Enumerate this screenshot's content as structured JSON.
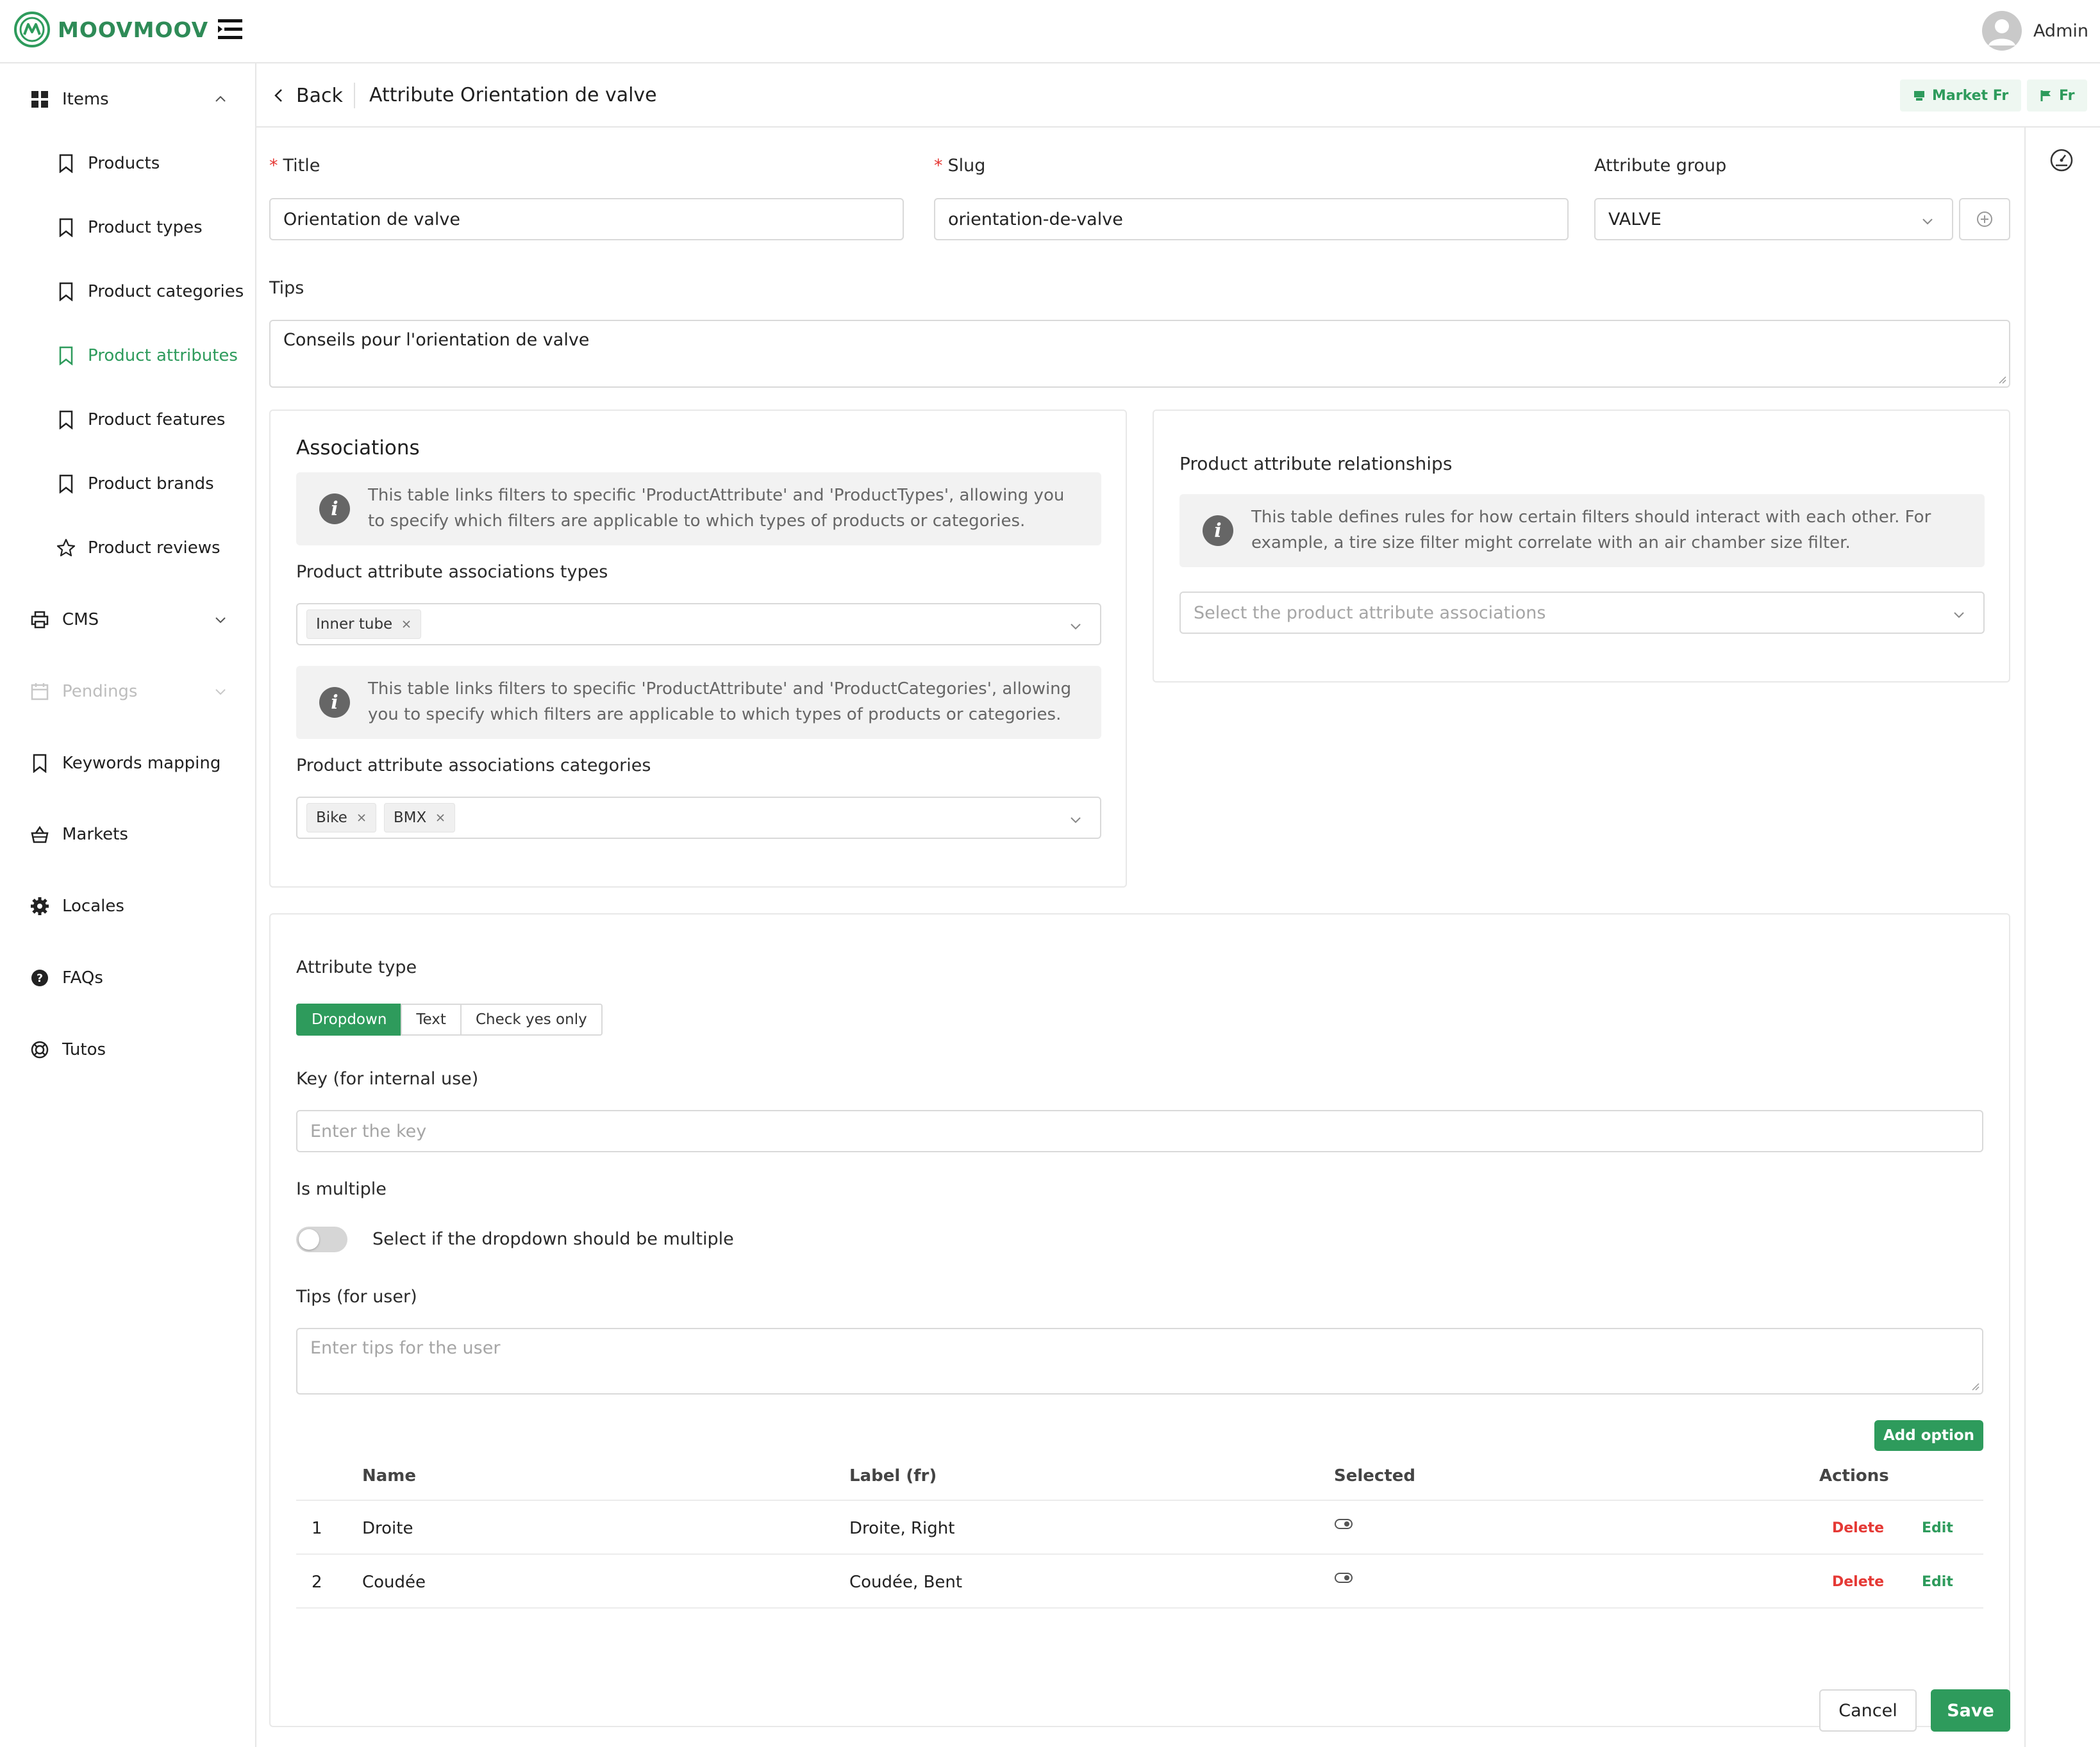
{
  "app": {
    "brand": "MOOVMOOV",
    "user": "Admin"
  },
  "colors": {
    "accent": "#2e9b5c",
    "danger": "#e53935",
    "muted": "#bdbdbd"
  },
  "sidebar": {
    "items": [
      {
        "label": "Items",
        "icon": "grid-icon"
      },
      {
        "label": "Products",
        "icon": "bookmark-icon"
      },
      {
        "label": "Product types",
        "icon": "bookmark-icon"
      },
      {
        "label": "Product categories",
        "icon": "bookmark-icon"
      },
      {
        "label": "Product attributes",
        "icon": "bookmark-icon"
      },
      {
        "label": "Product features",
        "icon": "bookmark-icon"
      },
      {
        "label": "Product brands",
        "icon": "bookmark-icon"
      },
      {
        "label": "Product reviews",
        "icon": "star-icon"
      },
      {
        "label": "CMS",
        "icon": "printer-icon"
      },
      {
        "label": "Pendings",
        "icon": "calendar-icon"
      },
      {
        "label": "Keywords mapping",
        "icon": "bookmark-icon"
      },
      {
        "label": "Markets",
        "icon": "basket-icon"
      },
      {
        "label": "Locales",
        "icon": "gear-icon"
      },
      {
        "label": "FAQs",
        "icon": "question-icon"
      },
      {
        "label": "Tutos",
        "icon": "lifebuoy-icon"
      }
    ]
  },
  "header": {
    "back_label": "Back",
    "title": "Attribute Orientation de valve",
    "market_label": "Market Fr",
    "locale_label": "Fr"
  },
  "form": {
    "title_label": "Title",
    "title_value": "Orientation de valve",
    "slug_label": "Slug",
    "slug_value": "orientation-de-valve",
    "group_label": "Attribute group",
    "group_value": "VALVE",
    "tips_label": "Tips",
    "tips_value": "Conseils pour l'orientation de valve"
  },
  "associations": {
    "title": "Associations",
    "info_types": "This table links filters to specific 'ProductAttribute' and 'ProductTypes', allowing you to specify which filters are applicable to which types of products or categories.",
    "types_label": "Product attribute associations types",
    "types_tags": [
      "Inner tube"
    ],
    "info_categories": "This table links filters to specific 'ProductAttribute' and 'ProductCategories', allowing you to specify which filters are applicable to which types of products or categories.",
    "categories_label": "Product attribute associations categories",
    "categories_tags": [
      "Bike",
      "BMX"
    ]
  },
  "relationships": {
    "title": "Product attribute relationships",
    "info": "This table defines rules for how certain filters should interact with each other. For example, a tire size filter might correlate with an air chamber size filter.",
    "select_placeholder": "Select the product attribute associations"
  },
  "attribute_type": {
    "label": "Attribute type",
    "options": [
      "Dropdown",
      "Text",
      "Check yes only"
    ],
    "selected": "Dropdown",
    "key_label": "Key (for internal use)",
    "key_placeholder": "Enter the key",
    "multiple_label": "Is multiple",
    "multiple_toggle_label": "Select if the dropdown should be multiple",
    "multiple_on": false,
    "user_tips_label": "Tips (for user)",
    "user_tips_placeholder": "Enter tips for the user",
    "add_option_label": "Add option"
  },
  "options_table": {
    "columns": [
      "Name",
      "Label (fr)",
      "Selected",
      "Actions"
    ],
    "rows": [
      {
        "index": "1",
        "name": "Droite",
        "label": "Droite, Right"
      },
      {
        "index": "2",
        "name": "Coudée",
        "label": "Coudée, Bent"
      }
    ],
    "delete_label": "Delete",
    "edit_label": "Edit"
  },
  "footer": {
    "cancel_label": "Cancel",
    "save_label": "Save"
  }
}
